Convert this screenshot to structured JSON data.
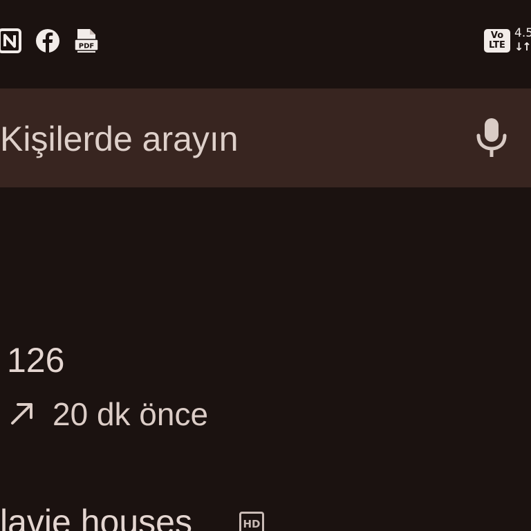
{
  "status_bar": {
    "left_icons": [
      "nfc-icon",
      "facebook-icon",
      "pdf-file-icon"
    ],
    "pdf_label": "PDF",
    "volte_line1": "Vo",
    "volte_line2": "LTE",
    "net_speed": "4.5",
    "net_arrows": "↓↑"
  },
  "search": {
    "placeholder": "Kişilerde arayın",
    "mic_icon": "microphone-icon"
  },
  "call_log": [
    {
      "name": "126",
      "direction_icon": "outgoing-call-arrow-icon",
      "time": "20 dk önce"
    },
    {
      "name": "lavie houses",
      "badge": "HD"
    }
  ],
  "colors": {
    "background": "#1b1210",
    "search_bar": "#382520",
    "text_primary": "#e4d6d1"
  }
}
